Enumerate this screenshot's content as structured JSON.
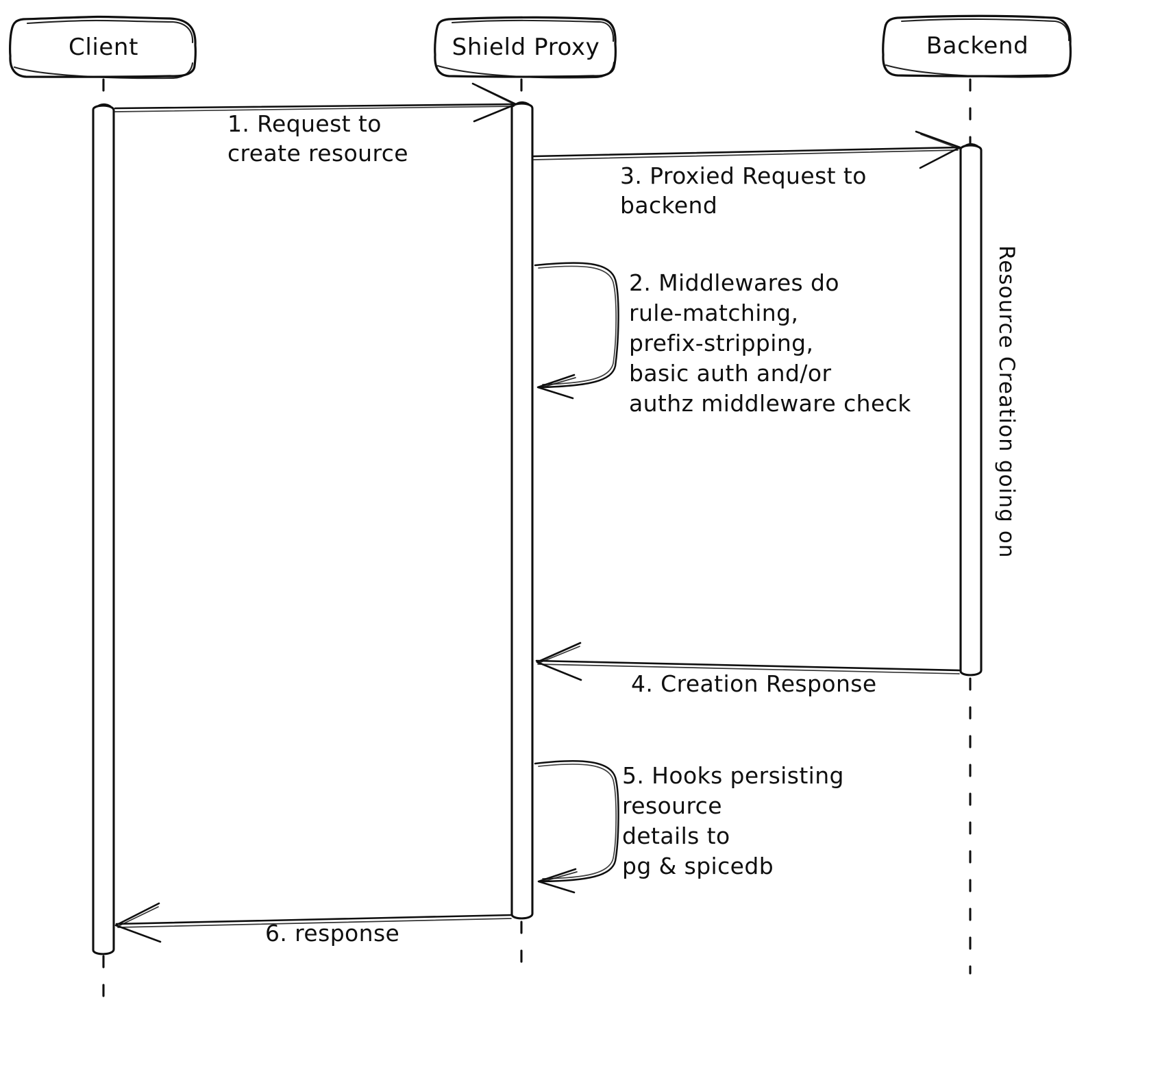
{
  "diagram": {
    "type": "sequence-diagram",
    "style": "hand-drawn",
    "background_color": "#ffffff",
    "stroke_color": "#0f0f0f",
    "participants": [
      {
        "id": "client",
        "label": "Client"
      },
      {
        "id": "shield_proxy",
        "label": "Shield Proxy"
      },
      {
        "id": "backend",
        "label": "Backend"
      }
    ],
    "messages": [
      {
        "number": "1",
        "label": "1. Request to\ncreate resource",
        "from": "client",
        "to": "shield_proxy",
        "kind": "call"
      },
      {
        "number": "3",
        "label": "3. Proxied Request to\nbackend",
        "from": "shield_proxy",
        "to": "backend",
        "kind": "call"
      },
      {
        "number": "2",
        "label": "2. Middlewares do\nrule-matching,\nprefix-stripping,\nbasic auth and/or\nauthz middleware check",
        "from": "shield_proxy",
        "to": "shield_proxy",
        "kind": "self"
      },
      {
        "number": "4",
        "label": "4. Creation Response",
        "from": "backend",
        "to": "shield_proxy",
        "kind": "return"
      },
      {
        "number": "5",
        "label": "5. Hooks persisting\nresource\ndetails to\npg & spicedb",
        "from": "shield_proxy",
        "to": "shield_proxy",
        "kind": "self"
      },
      {
        "number": "6",
        "label": "6. response",
        "from": "shield_proxy",
        "to": "client",
        "kind": "return"
      }
    ],
    "notes": [
      {
        "id": "backend-activity-note",
        "label": "Resource Creation going on",
        "orientation": "vertical",
        "attached_to": "backend"
      }
    ]
  }
}
